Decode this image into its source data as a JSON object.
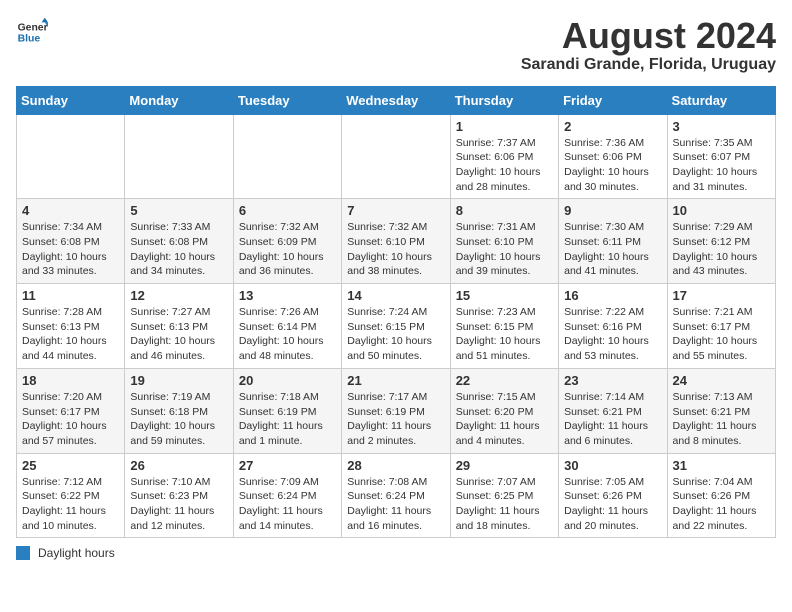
{
  "header": {
    "logo_general": "General",
    "logo_blue": "Blue",
    "month_year": "August 2024",
    "location": "Sarandi Grande, Florida, Uruguay"
  },
  "days_of_week": [
    "Sunday",
    "Monday",
    "Tuesday",
    "Wednesday",
    "Thursday",
    "Friday",
    "Saturday"
  ],
  "weeks": [
    [
      {
        "day": "",
        "info": ""
      },
      {
        "day": "",
        "info": ""
      },
      {
        "day": "",
        "info": ""
      },
      {
        "day": "",
        "info": ""
      },
      {
        "day": "1",
        "info": "Sunrise: 7:37 AM\nSunset: 6:06 PM\nDaylight: 10 hours and 28 minutes."
      },
      {
        "day": "2",
        "info": "Sunrise: 7:36 AM\nSunset: 6:06 PM\nDaylight: 10 hours and 30 minutes."
      },
      {
        "day": "3",
        "info": "Sunrise: 7:35 AM\nSunset: 6:07 PM\nDaylight: 10 hours and 31 minutes."
      }
    ],
    [
      {
        "day": "4",
        "info": "Sunrise: 7:34 AM\nSunset: 6:08 PM\nDaylight: 10 hours and 33 minutes."
      },
      {
        "day": "5",
        "info": "Sunrise: 7:33 AM\nSunset: 6:08 PM\nDaylight: 10 hours and 34 minutes."
      },
      {
        "day": "6",
        "info": "Sunrise: 7:32 AM\nSunset: 6:09 PM\nDaylight: 10 hours and 36 minutes."
      },
      {
        "day": "7",
        "info": "Sunrise: 7:32 AM\nSunset: 6:10 PM\nDaylight: 10 hours and 38 minutes."
      },
      {
        "day": "8",
        "info": "Sunrise: 7:31 AM\nSunset: 6:10 PM\nDaylight: 10 hours and 39 minutes."
      },
      {
        "day": "9",
        "info": "Sunrise: 7:30 AM\nSunset: 6:11 PM\nDaylight: 10 hours and 41 minutes."
      },
      {
        "day": "10",
        "info": "Sunrise: 7:29 AM\nSunset: 6:12 PM\nDaylight: 10 hours and 43 minutes."
      }
    ],
    [
      {
        "day": "11",
        "info": "Sunrise: 7:28 AM\nSunset: 6:13 PM\nDaylight: 10 hours and 44 minutes."
      },
      {
        "day": "12",
        "info": "Sunrise: 7:27 AM\nSunset: 6:13 PM\nDaylight: 10 hours and 46 minutes."
      },
      {
        "day": "13",
        "info": "Sunrise: 7:26 AM\nSunset: 6:14 PM\nDaylight: 10 hours and 48 minutes."
      },
      {
        "day": "14",
        "info": "Sunrise: 7:24 AM\nSunset: 6:15 PM\nDaylight: 10 hours and 50 minutes."
      },
      {
        "day": "15",
        "info": "Sunrise: 7:23 AM\nSunset: 6:15 PM\nDaylight: 10 hours and 51 minutes."
      },
      {
        "day": "16",
        "info": "Sunrise: 7:22 AM\nSunset: 6:16 PM\nDaylight: 10 hours and 53 minutes."
      },
      {
        "day": "17",
        "info": "Sunrise: 7:21 AM\nSunset: 6:17 PM\nDaylight: 10 hours and 55 minutes."
      }
    ],
    [
      {
        "day": "18",
        "info": "Sunrise: 7:20 AM\nSunset: 6:17 PM\nDaylight: 10 hours and 57 minutes."
      },
      {
        "day": "19",
        "info": "Sunrise: 7:19 AM\nSunset: 6:18 PM\nDaylight: 10 hours and 59 minutes."
      },
      {
        "day": "20",
        "info": "Sunrise: 7:18 AM\nSunset: 6:19 PM\nDaylight: 11 hours and 1 minute."
      },
      {
        "day": "21",
        "info": "Sunrise: 7:17 AM\nSunset: 6:19 PM\nDaylight: 11 hours and 2 minutes."
      },
      {
        "day": "22",
        "info": "Sunrise: 7:15 AM\nSunset: 6:20 PM\nDaylight: 11 hours and 4 minutes."
      },
      {
        "day": "23",
        "info": "Sunrise: 7:14 AM\nSunset: 6:21 PM\nDaylight: 11 hours and 6 minutes."
      },
      {
        "day": "24",
        "info": "Sunrise: 7:13 AM\nSunset: 6:21 PM\nDaylight: 11 hours and 8 minutes."
      }
    ],
    [
      {
        "day": "25",
        "info": "Sunrise: 7:12 AM\nSunset: 6:22 PM\nDaylight: 11 hours and 10 minutes."
      },
      {
        "day": "26",
        "info": "Sunrise: 7:10 AM\nSunset: 6:23 PM\nDaylight: 11 hours and 12 minutes."
      },
      {
        "day": "27",
        "info": "Sunrise: 7:09 AM\nSunset: 6:24 PM\nDaylight: 11 hours and 14 minutes."
      },
      {
        "day": "28",
        "info": "Sunrise: 7:08 AM\nSunset: 6:24 PM\nDaylight: 11 hours and 16 minutes."
      },
      {
        "day": "29",
        "info": "Sunrise: 7:07 AM\nSunset: 6:25 PM\nDaylight: 11 hours and 18 minutes."
      },
      {
        "day": "30",
        "info": "Sunrise: 7:05 AM\nSunset: 6:26 PM\nDaylight: 11 hours and 20 minutes."
      },
      {
        "day": "31",
        "info": "Sunrise: 7:04 AM\nSunset: 6:26 PM\nDaylight: 11 hours and 22 minutes."
      }
    ]
  ],
  "footer": {
    "legend_label": "Daylight hours"
  }
}
